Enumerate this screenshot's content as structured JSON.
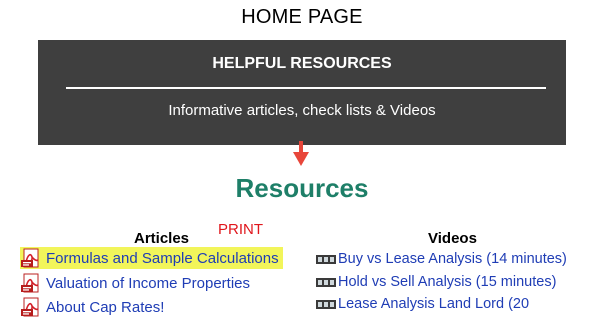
{
  "page": {
    "title": "HOME PAGE"
  },
  "banner": {
    "heading": "HELPFUL RESOURCES",
    "subtitle": "Informative articles, check lists & Videos"
  },
  "resources": {
    "title": "Resources",
    "print_label": "PRINT",
    "articles": {
      "heading": "Articles",
      "items": [
        {
          "label": "Formulas and Sample Calculations",
          "icon": "pdf-icon",
          "highlighted": true
        },
        {
          "label": "Valuation of Income Properties",
          "icon": "pdf-icon",
          "highlighted": false
        },
        {
          "label": "About Cap Rates!",
          "icon": "pdf-icon",
          "highlighted": false
        }
      ]
    },
    "videos": {
      "heading": "Videos",
      "items": [
        {
          "label": "Buy vs Lease Analysis (14 minutes)",
          "icon": "film-icon"
        },
        {
          "label": "Hold vs Sell Analysis (15 minutes)",
          "icon": "film-icon"
        },
        {
          "label": "Lease Analysis Land Lord (20",
          "icon": "film-icon"
        }
      ]
    }
  },
  "colors": {
    "banner_bg": "#3f3f3f",
    "resources_title": "#1e7f68",
    "link": "#1f3db5",
    "print": "#e0161c",
    "arrow": "#e8463a",
    "highlight": "#f2f55a"
  }
}
